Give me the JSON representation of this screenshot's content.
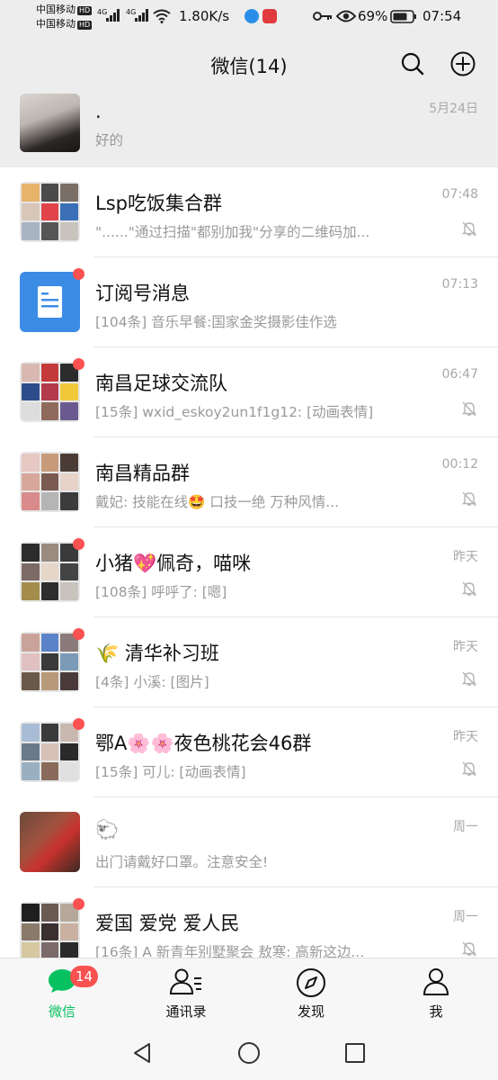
{
  "status_bar": {
    "carrier1": "中国移动",
    "carrier2": "中国移动",
    "hd": "HD",
    "net1": "4G",
    "net2": "4G",
    "speed": "1.80K/s",
    "battery": "69%",
    "time": "07:54"
  },
  "header": {
    "title": "微信(14)"
  },
  "chats": [
    {
      "name": "  .",
      "message": "好的",
      "time": "5月24日",
      "pinned": true,
      "unread_dot": false,
      "muted": false
    },
    {
      "name": "Lsp吃饭集合群",
      "message": "\"......\"通过扫描\"都别加我\"分享的二维码加...",
      "time": "07:48",
      "pinned": false,
      "unread_dot": false,
      "muted": true
    },
    {
      "name": "订阅号消息",
      "message": "[104条] 音乐早餐:国家金奖摄影佳作选",
      "time": "07:13",
      "pinned": false,
      "unread_dot": true,
      "muted": false
    },
    {
      "name": "南昌足球交流队",
      "message": "[15条] wxid_eskoy2un1f1g12: [动画表情]",
      "time": "06:47",
      "pinned": false,
      "unread_dot": true,
      "muted": true
    },
    {
      "name": "南昌精品群",
      "message": "戴妃: 技能在线🤩    口技一绝    万种风情...",
      "time": "00:12",
      "pinned": false,
      "unread_dot": false,
      "muted": true
    },
    {
      "name": "小猪💖佩奇，喵咪",
      "message": "[108条] 呼呼了: [嗯]",
      "time": "昨天",
      "pinned": false,
      "unread_dot": true,
      "muted": true
    },
    {
      "name": "🌾 清华补习班",
      "message": "[4条] 小溪: [图片]",
      "time": "昨天",
      "pinned": false,
      "unread_dot": true,
      "muted": true
    },
    {
      "name": "鄂A🌸🌸夜色桃花会46群",
      "message": "[15条] 可儿: [动画表情]",
      "time": "昨天",
      "pinned": false,
      "unread_dot": true,
      "muted": true
    },
    {
      "name": "🐑",
      "message": "出门请戴好口罩。注意安全!",
      "time": "周一",
      "pinned": false,
      "unread_dot": false,
      "muted": false
    },
    {
      "name": "爱国 爱党 爱人民",
      "message": "[16条] A 新青年别墅聚会 敖寒: 高新这边...",
      "time": "周一",
      "pinned": false,
      "unread_dot": true,
      "muted": true
    }
  ],
  "tabs": [
    {
      "label": "微信",
      "icon": "chat-bubble-icon",
      "active": true,
      "badge": "14"
    },
    {
      "label": "通讯录",
      "icon": "contacts-icon",
      "active": false
    },
    {
      "label": "发现",
      "icon": "compass-icon",
      "active": false
    },
    {
      "label": "我",
      "icon": "person-icon",
      "active": false
    }
  ],
  "colors": {
    "accent": "#07c160",
    "badge": "#fa5151",
    "background": "#ededed"
  }
}
